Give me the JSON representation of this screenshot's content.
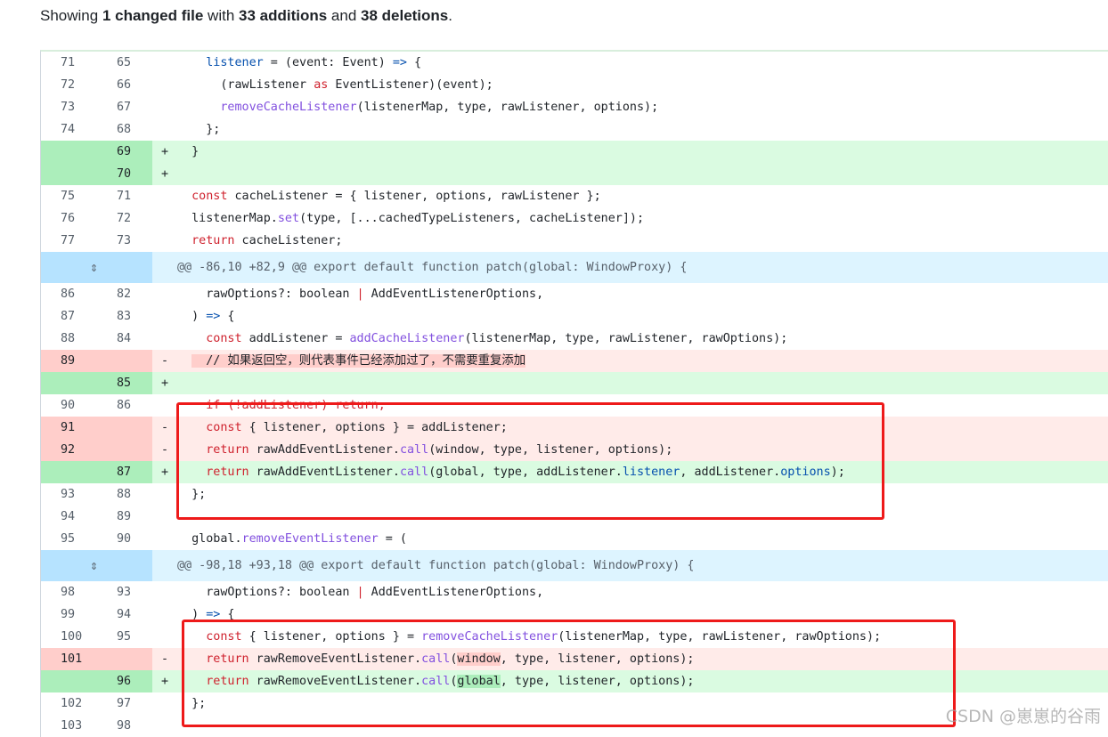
{
  "summary": {
    "prefix": "Showing ",
    "changed": "1 changed file",
    "with": " with ",
    "additions": "33 additions",
    "and": " and ",
    "deletions": "38 deletions",
    "suffix": "."
  },
  "rows": [
    {
      "type": "ctx",
      "old": "71",
      "new": "65",
      "mark": "",
      "code": [
        [
          "    ",
          ""
        ],
        [
          "listener",
          "p"
        ],
        [
          " = (event: Event) ",
          ""
        ],
        [
          "=>",
          "p"
        ],
        [
          " {",
          ""
        ]
      ]
    },
    {
      "type": "ctx",
      "old": "72",
      "new": "66",
      "mark": "",
      "code": [
        [
          "      (rawListener ",
          ""
        ],
        [
          "as",
          "k"
        ],
        [
          " EventListener)(event);",
          ""
        ]
      ]
    },
    {
      "type": "ctx",
      "old": "73",
      "new": "67",
      "mark": "",
      "code": [
        [
          "      ",
          ""
        ],
        [
          "removeCacheListener",
          "f"
        ],
        [
          "(listenerMap, type, rawListener, options);",
          ""
        ]
      ]
    },
    {
      "type": "ctx",
      "old": "74",
      "new": "68",
      "mark": "",
      "code": [
        [
          "    };",
          ""
        ]
      ]
    },
    {
      "type": "add",
      "old": "",
      "new": "69",
      "mark": "+",
      "code": [
        [
          "  }",
          ""
        ]
      ]
    },
    {
      "type": "add",
      "old": "",
      "new": "70",
      "mark": "+",
      "code": [
        [
          "",
          ""
        ]
      ]
    },
    {
      "type": "ctx",
      "old": "75",
      "new": "71",
      "mark": "",
      "code": [
        [
          "  ",
          ""
        ],
        [
          "const",
          "k"
        ],
        [
          " cacheListener = { listener, options, rawListener };",
          ""
        ]
      ]
    },
    {
      "type": "ctx",
      "old": "76",
      "new": "72",
      "mark": "",
      "code": [
        [
          "  listenerMap.",
          ""
        ],
        [
          "set",
          "f"
        ],
        [
          "(type, [...cachedTypeListeners, cacheListener]);",
          ""
        ]
      ]
    },
    {
      "type": "ctx",
      "old": "77",
      "new": "73",
      "mark": "",
      "code": [
        [
          "  ",
          ""
        ],
        [
          "return",
          "k"
        ],
        [
          " cacheListener;",
          ""
        ]
      ]
    },
    {
      "type": "hunk",
      "text": "@@ -86,10 +82,9 @@ export default function patch(global: WindowProxy) {"
    },
    {
      "type": "ctx",
      "old": "86",
      "new": "82",
      "mark": "",
      "code": [
        [
          "    rawOptions?: boolean ",
          ""
        ],
        [
          "|",
          "k"
        ],
        [
          " AddEventListenerOptions,",
          ""
        ]
      ]
    },
    {
      "type": "ctx",
      "old": "87",
      "new": "83",
      "mark": "",
      "code": [
        [
          "  ) ",
          ""
        ],
        [
          "=>",
          "p"
        ],
        [
          " {",
          ""
        ]
      ]
    },
    {
      "type": "ctx",
      "old": "88",
      "new": "84",
      "mark": "",
      "code": [
        [
          "    ",
          ""
        ],
        [
          "const",
          "k"
        ],
        [
          " addListener = ",
          ""
        ],
        [
          "addCacheListener",
          "f"
        ],
        [
          "(listenerMap, type, rawListener, rawOptions);",
          ""
        ]
      ]
    },
    {
      "type": "del",
      "old": "89",
      "new": "",
      "mark": "-",
      "code": [
        [
          "  ",
          ""
        ],
        [
          "  // 如果返回空，则代表事件已经添加过了，不需要重复添加",
          "hl-cmt"
        ]
      ]
    },
    {
      "type": "add",
      "old": "",
      "new": "85",
      "mark": "+",
      "code": [
        [
          "",
          ""
        ]
      ]
    },
    {
      "type": "ctx",
      "old": "90",
      "new": "86",
      "mark": "",
      "code": [
        [
          "    ",
          ""
        ],
        [
          "if (!addListener) return;",
          "strike"
        ]
      ]
    },
    {
      "type": "del",
      "old": "91",
      "new": "",
      "mark": "-",
      "code": [
        [
          "    ",
          ""
        ],
        [
          "const",
          "k"
        ],
        [
          " { listener, options } = addListener;",
          ""
        ]
      ]
    },
    {
      "type": "del",
      "old": "92",
      "new": "",
      "mark": "-",
      "code": [
        [
          "    ",
          ""
        ],
        [
          "return",
          "k"
        ],
        [
          " rawAddEventListener.",
          ""
        ],
        [
          "call",
          "f"
        ],
        [
          "(window, type, listener, options);",
          ""
        ]
      ]
    },
    {
      "type": "add",
      "old": "",
      "new": "87",
      "mark": "+",
      "code": [
        [
          "    ",
          ""
        ],
        [
          "return",
          "k"
        ],
        [
          " rawAddEventListener.",
          ""
        ],
        [
          "call",
          "f"
        ],
        [
          "(global, type, addListener.",
          ""
        ],
        [
          "listener",
          "p"
        ],
        [
          ", addListener.",
          ""
        ],
        [
          "options",
          "p"
        ],
        [
          ");",
          ""
        ]
      ]
    },
    {
      "type": "ctx",
      "old": "93",
      "new": "88",
      "mark": "",
      "code": [
        [
          "  };",
          ""
        ]
      ]
    },
    {
      "type": "ctx",
      "old": "94",
      "new": "89",
      "mark": "",
      "code": [
        [
          "",
          ""
        ]
      ]
    },
    {
      "type": "ctx",
      "old": "95",
      "new": "90",
      "mark": "",
      "code": [
        [
          "  global.",
          ""
        ],
        [
          "removeEventListener",
          "f"
        ],
        [
          " = (",
          ""
        ]
      ]
    },
    {
      "type": "hunk",
      "text": "@@ -98,18 +93,18 @@ export default function patch(global: WindowProxy) {"
    },
    {
      "type": "ctx",
      "old": "98",
      "new": "93",
      "mark": "",
      "code": [
        [
          "    rawOptions?: boolean ",
          ""
        ],
        [
          "|",
          "k"
        ],
        [
          " AddEventListenerOptions,",
          ""
        ]
      ]
    },
    {
      "type": "ctx",
      "old": "99",
      "new": "94",
      "mark": "",
      "code": [
        [
          "  ) ",
          ""
        ],
        [
          "=>",
          "p"
        ],
        [
          " {",
          ""
        ]
      ]
    },
    {
      "type": "ctx",
      "old": "100",
      "new": "95",
      "mark": "",
      "code": [
        [
          "    ",
          ""
        ],
        [
          "const",
          "k"
        ],
        [
          " { listener, options } = ",
          ""
        ],
        [
          "removeCacheListener",
          "f"
        ],
        [
          "(listenerMap, type, rawListener, rawOptions);",
          ""
        ]
      ]
    },
    {
      "type": "del",
      "old": "101",
      "new": "",
      "mark": "-",
      "code": [
        [
          "    ",
          ""
        ],
        [
          "return",
          "k"
        ],
        [
          " rawRemoveEventListener.",
          ""
        ],
        [
          "call",
          "f"
        ],
        [
          "(",
          ""
        ],
        [
          "window",
          "hl-del"
        ],
        [
          ", type, listener, options);",
          ""
        ]
      ]
    },
    {
      "type": "add",
      "old": "",
      "new": "96",
      "mark": "+",
      "code": [
        [
          "    ",
          ""
        ],
        [
          "return",
          "k"
        ],
        [
          " rawRemoveEventListener.",
          ""
        ],
        [
          "call",
          "f"
        ],
        [
          "(",
          ""
        ],
        [
          "global",
          "hl-add"
        ],
        [
          ", type, listener, options);",
          ""
        ]
      ]
    },
    {
      "type": "ctx",
      "old": "102",
      "new": "97",
      "mark": "",
      "code": [
        [
          "  };",
          ""
        ]
      ]
    },
    {
      "type": "ctx",
      "old": "103",
      "new": "98",
      "mark": "",
      "code": [
        [
          "",
          ""
        ]
      ]
    }
  ],
  "watermark": "CSDN @崽崽的谷雨",
  "colors": {
    "annotation_box": "#ee1a1a",
    "add_bg": "#dafbe1",
    "del_bg": "#ffebe9",
    "hunk_bg": "#ddf4ff"
  }
}
